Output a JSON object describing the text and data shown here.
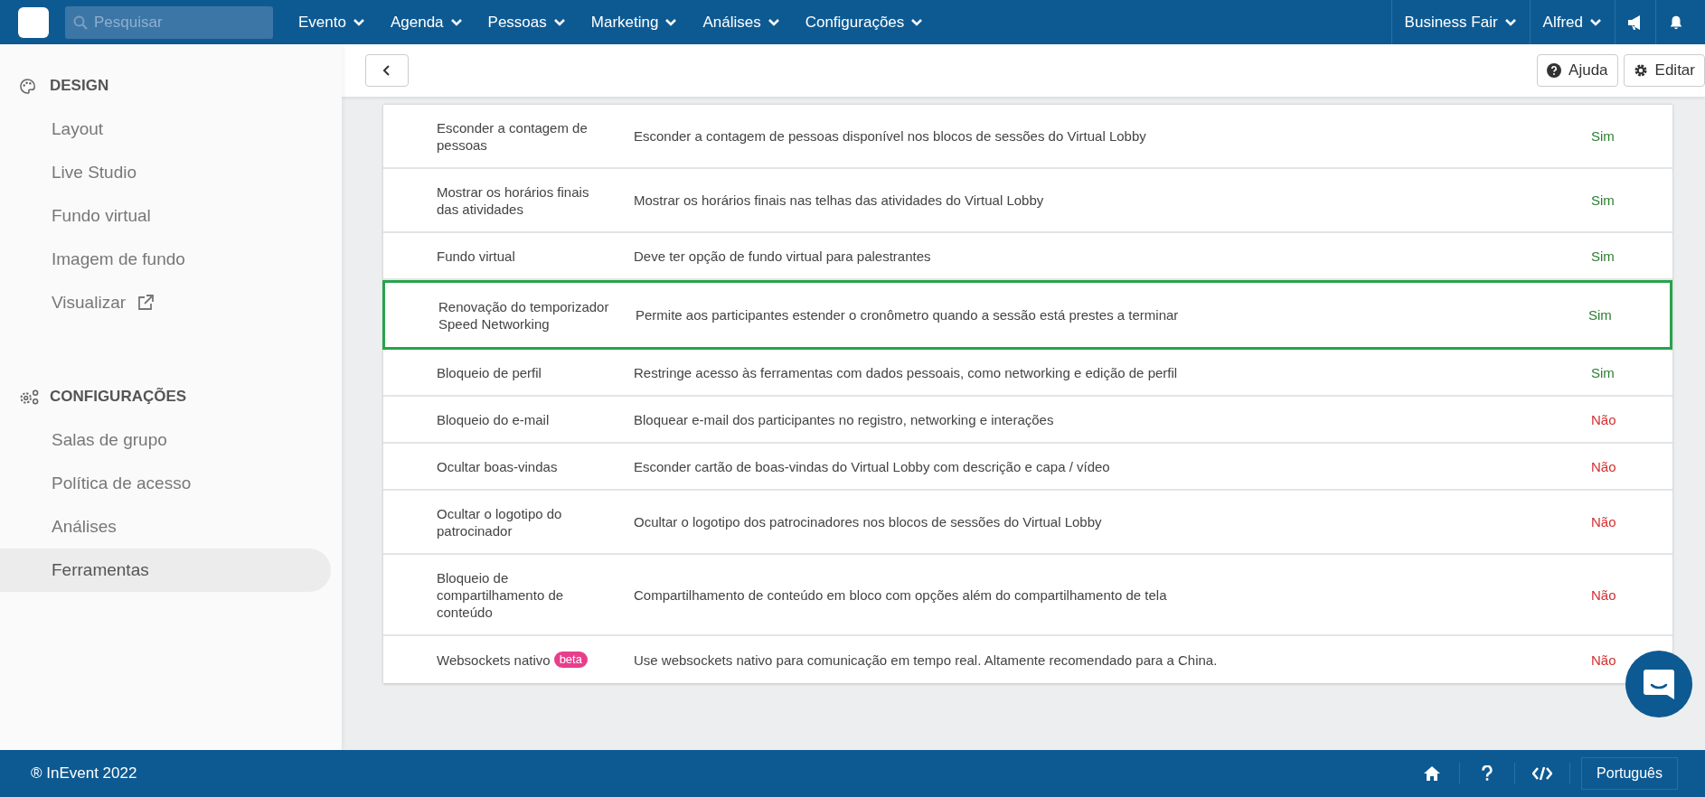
{
  "top_bar": {
    "search": {
      "placeholder": "Pesquisar"
    },
    "menus": [
      {
        "label": "Evento"
      },
      {
        "label": "Agenda"
      },
      {
        "label": "Pessoas"
      },
      {
        "label": "Marketing"
      },
      {
        "label": "Análises"
      },
      {
        "label": "Configurações"
      }
    ],
    "right_menus": [
      {
        "label": "Business Fair"
      },
      {
        "label": "Alfred"
      }
    ]
  },
  "sidebar": {
    "sections": [
      {
        "title": "DESIGN",
        "kind": "palette",
        "items": [
          {
            "label": "Layout",
            "selected": false,
            "external": false
          },
          {
            "label": "Live Studio",
            "selected": false,
            "external": false
          },
          {
            "label": "Fundo virtual",
            "selected": false,
            "external": false
          },
          {
            "label": "Imagem de fundo",
            "selected": false,
            "external": false
          },
          {
            "label": "Visualizar",
            "selected": false,
            "external": true
          }
        ]
      },
      {
        "title": "CONFIGURAÇÕES",
        "kind": "gears",
        "items": [
          {
            "label": "Salas de grupo",
            "selected": false,
            "external": false
          },
          {
            "label": "Política de acesso",
            "selected": false,
            "external": false
          },
          {
            "label": "Análises",
            "selected": false,
            "external": false
          },
          {
            "label": "Ferramentas",
            "selected": true,
            "external": false
          }
        ]
      }
    ]
  },
  "toolbar": {
    "buttons": [
      {
        "label": "Ajuda",
        "kind": "help"
      },
      {
        "label": "Editar",
        "kind": "edit"
      }
    ]
  },
  "table": {
    "rows": [
      {
        "name": "Esconder a contagem de pessoas",
        "description": "Esconder a contagem de pessoas disponível nos blocos de sessões do Virtual Lobby",
        "value": "Sim",
        "enabled": true,
        "highlighted": false
      },
      {
        "name": "Mostrar os horários finais das atividades",
        "description": "Mostrar os horários finais nas telhas das atividades do Virtual Lobby",
        "value": "Sim",
        "enabled": true,
        "highlighted": false
      },
      {
        "name": "Fundo virtual",
        "description": "Deve ter opção de fundo virtual para palestrantes",
        "value": "Sim",
        "enabled": true,
        "highlighted": false
      },
      {
        "name": "Renovação do temporizador Speed Networking",
        "description": "Permite aos participantes estender o cronômetro quando a sessão está prestes a terminar",
        "value": "Sim",
        "enabled": true,
        "highlighted": true
      },
      {
        "name": "Bloqueio de perfil",
        "description": "Restringe acesso às ferramentas com dados pessoais, como networking e edição de perfil",
        "value": "Sim",
        "enabled": true,
        "highlighted": false
      },
      {
        "name": "Bloqueio do e-mail",
        "description": "Bloquear e-mail dos participantes no registro, networking e interações",
        "value": "Não",
        "enabled": false,
        "highlighted": false
      },
      {
        "name": "Ocultar boas-vindas",
        "description": "Esconder cartão de boas-vindas do Virtual Lobby com descrição e capa / vídeo",
        "value": "Não",
        "enabled": false,
        "highlighted": false
      },
      {
        "name": "Ocultar o logotipo do patrocinador",
        "description": "Ocultar o logotipo dos patrocinadores nos blocos de sessões do Virtual Lobby",
        "value": "Não",
        "enabled": false,
        "highlighted": false
      },
      {
        "name": "Bloqueio de compartilhamento de conteúdo",
        "description": "Compartilhamento de conteúdo em bloco com opções além do compartilhamento de tela",
        "value": "Não",
        "enabled": false,
        "highlighted": false
      },
      {
        "name": "Websockets nativo",
        "badge": "beta",
        "description": "Use websockets nativo para comunicação em tempo real. Altamente recomendado para a China.",
        "value": "Não",
        "enabled": false,
        "highlighted": false
      }
    ]
  },
  "footer": {
    "copyright": "® InEvent 2022",
    "language": "Português"
  }
}
